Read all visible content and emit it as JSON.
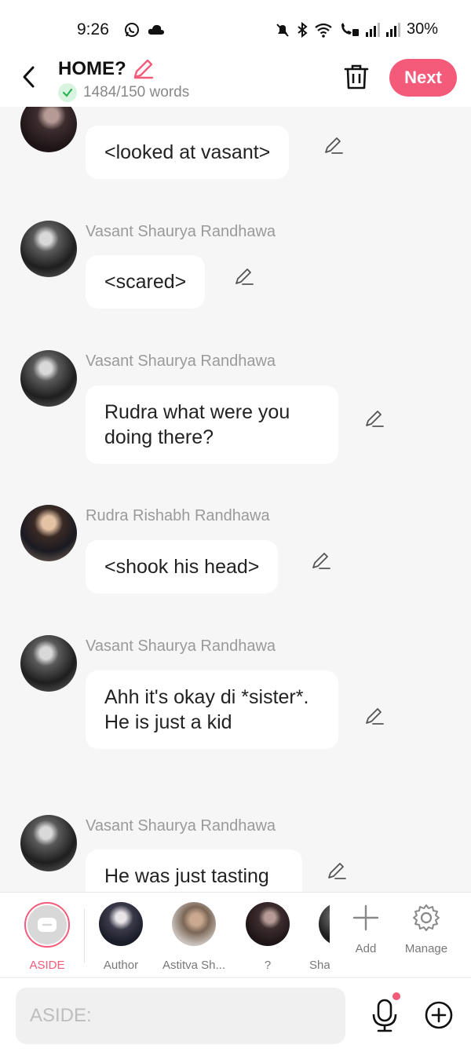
{
  "status_bar": {
    "time": "9:26",
    "battery": "30%"
  },
  "header": {
    "title": "HOME?",
    "word_count": "1484/150 words",
    "next_label": "Next",
    "accent_color": "#f45a7a"
  },
  "messages": [
    {
      "sender": "",
      "text": "<looked at vasant>",
      "avatar": "woman-avatar"
    },
    {
      "sender": "Vasant Shaurya Randhawa",
      "text": "<scared>",
      "avatar": "vasant-avatar"
    },
    {
      "sender": "Vasant Shaurya Randhawa",
      "text": "Rudra what were you doing there?",
      "avatar": "vasant-avatar"
    },
    {
      "sender": "Rudra Rishabh Randhawa",
      "text": "<shook his head>",
      "avatar": "rudra-avatar"
    },
    {
      "sender": "Vasant Shaurya Randhawa",
      "text": "Ahh it's okay di *sister*. He is just a kid",
      "avatar": "vasant-avatar"
    },
    {
      "sender": "Vasant Shaurya Randhawa",
      "text": "He was just tasting",
      "avatar": "vasant-avatar"
    }
  ],
  "characters": [
    {
      "label": "ASIDE",
      "selected": true
    },
    {
      "label": "Author"
    },
    {
      "label": "Astitva Sh..."
    },
    {
      "label": "?"
    },
    {
      "label": "Sha"
    }
  ],
  "tools": {
    "add_label": "Add",
    "manage_label": "Manage"
  },
  "composer": {
    "placeholder": "ASIDE:"
  }
}
